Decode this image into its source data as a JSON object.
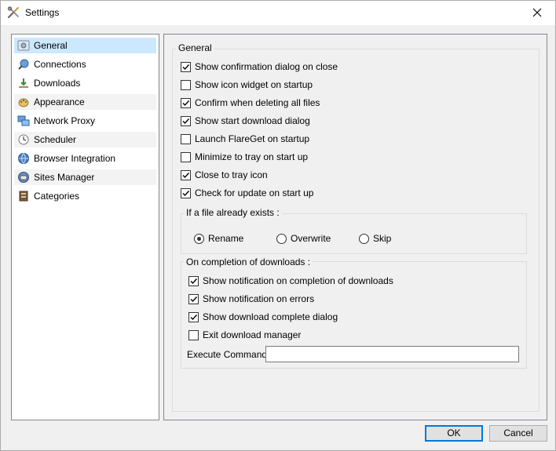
{
  "window": {
    "title": "Settings",
    "title_icon": "tools-icon",
    "close_icon": "close-icon"
  },
  "sidebar": {
    "items": [
      {
        "label": "General",
        "icon": "general-settings-icon",
        "selected": true
      },
      {
        "label": "Connections",
        "icon": "connections-icon"
      },
      {
        "label": "Downloads",
        "icon": "downloads-icon"
      },
      {
        "label": "Appearance",
        "icon": "appearance-icon"
      },
      {
        "label": "Network Proxy",
        "icon": "network-proxy-icon"
      },
      {
        "label": "Scheduler",
        "icon": "scheduler-icon"
      },
      {
        "label": "Browser Integration",
        "icon": "browser-integration-icon"
      },
      {
        "label": "Sites Manager",
        "icon": "sites-manager-icon"
      },
      {
        "label": "Categories",
        "icon": "categories-icon"
      }
    ]
  },
  "general": {
    "title": "General",
    "options": [
      {
        "label": "Show confirmation dialog on close",
        "checked": true
      },
      {
        "label": "Show icon widget on startup",
        "checked": false
      },
      {
        "label": "Confirm when deleting all files",
        "checked": true
      },
      {
        "label": "Show start download dialog",
        "checked": true
      },
      {
        "label": "Launch FlareGet on startup",
        "checked": false
      },
      {
        "label": "Minimize to tray on start up",
        "checked": false
      },
      {
        "label": "Close to tray icon",
        "checked": true
      },
      {
        "label": "Check for update on start up",
        "checked": true
      }
    ],
    "file_exists": {
      "title": "If a file already exists :",
      "options": [
        {
          "label": "Rename",
          "selected": true
        },
        {
          "label": "Overwrite",
          "selected": false
        },
        {
          "label": "Skip",
          "selected": false
        }
      ]
    },
    "completion": {
      "title": "On completion of downloads :",
      "options": [
        {
          "label": "Show notification on completion of downloads",
          "checked": true
        },
        {
          "label": "Show notification on errors",
          "checked": true
        },
        {
          "label": "Show download complete dialog",
          "checked": true
        },
        {
          "label": "Exit download manager",
          "checked": false
        }
      ],
      "execute_label": "Execute Command:",
      "execute_value": ""
    }
  },
  "buttons": {
    "ok": "OK",
    "cancel": "Cancel"
  }
}
